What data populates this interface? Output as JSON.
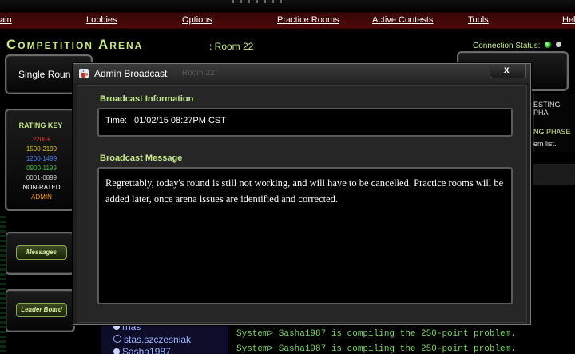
{
  "menu": {
    "items": [
      "ain",
      "Lobbies",
      "Options",
      "Practice Rooms",
      "Active Contests",
      "Tools",
      "Hel"
    ]
  },
  "header": {
    "title": "Competition Arena",
    "room": ": Room 22",
    "connection_status_label": "Connection Status:"
  },
  "left_panel": {
    "round_label": "Single Roun",
    "rating_key": {
      "title": "RATING KEY",
      "rows": [
        {
          "label": "2200+",
          "color": "#e23b2f"
        },
        {
          "label": "1500-2199",
          "color": "#e0c81a"
        },
        {
          "label": "1200-1499",
          "color": "#4b7cff"
        },
        {
          "label": "0900-1199",
          "color": "#3fbf3f"
        },
        {
          "label": "0001-0899",
          "color": "#cfcfcf"
        },
        {
          "label": "NON-RATED",
          "color": "#ffffff"
        },
        {
          "label": "ADMIN",
          "color": "#ff9a1a"
        }
      ]
    },
    "messages_button": "Messages",
    "leaderboard_button": "Leader Board"
  },
  "right_panel": {
    "phase_header": "ESTING PHA",
    "phase_green": "NG PHASE",
    "phase_list": "em list."
  },
  "background": {
    "users": [
      "rnas",
      "stas.szczesniak",
      "Sasha1987"
    ],
    "log_lines": [
      "System> Sasha1987 is compiling the 250-point problem.",
      "System> Sasha1987 is compiling the 250-point problem."
    ]
  },
  "dialog": {
    "title": "Admin Broadcast",
    "ghost_text": "Room 22",
    "close_label": "x",
    "info_section_label": "Broadcast Information",
    "time_label": "Time:",
    "time_value": "01/02/15 08:27PM CST",
    "message_section_label": "Broadcast Message",
    "message": "Regrettably, today's round is still not working, and will have to be cancelled. Practice rooms will be added later, once arena issues are identified and corrected."
  },
  "colors": {
    "accent_green": "#c8e88a",
    "menubar_red": "#4a0808",
    "status_led": "#1fb51f"
  }
}
